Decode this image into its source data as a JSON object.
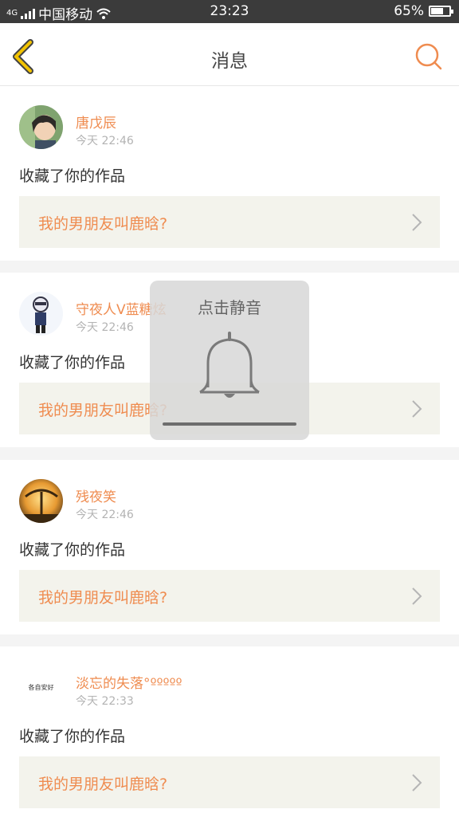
{
  "status_bar": {
    "carrier": "中国移动",
    "network": "4G",
    "time": "23:23",
    "battery": "65%"
  },
  "header": {
    "title": "消息"
  },
  "messages": [
    {
      "user": "唐戊辰",
      "time": "今天 22:46",
      "action": "收藏了你的作品",
      "work_title": "我的男朋友叫鹿晗?"
    },
    {
      "user": "守夜人V蓝糖炫",
      "time": "今天 22:46",
      "action": "收藏了你的作品",
      "work_title": "我的男朋友叫鹿晗?"
    },
    {
      "user": "残夜笑",
      "time": "今天 22:46",
      "action": "收藏了你的作品",
      "work_title": "我的男朋友叫鹿晗?"
    },
    {
      "user": "淡忘的失落°ººººº",
      "time": "今天 22:33",
      "action": "收藏了你的作品",
      "work_title": "我的男朋友叫鹿晗?",
      "avatar_text": "各自安好"
    }
  ],
  "toast": {
    "text": "点击静音"
  },
  "colors": {
    "accent": "#ef8c50",
    "back_icon": "#f2c300",
    "work_box_bg": "#f3f3ec",
    "status_bar_bg": "#3b3b3b"
  },
  "icons": {
    "back": "chevron-left-icon",
    "search": "search-icon",
    "item_arrow": "chevron-right-icon",
    "bell": "bell-icon",
    "wifi": "wifi-icon",
    "signal": "signal-icon",
    "battery": "battery-icon"
  }
}
